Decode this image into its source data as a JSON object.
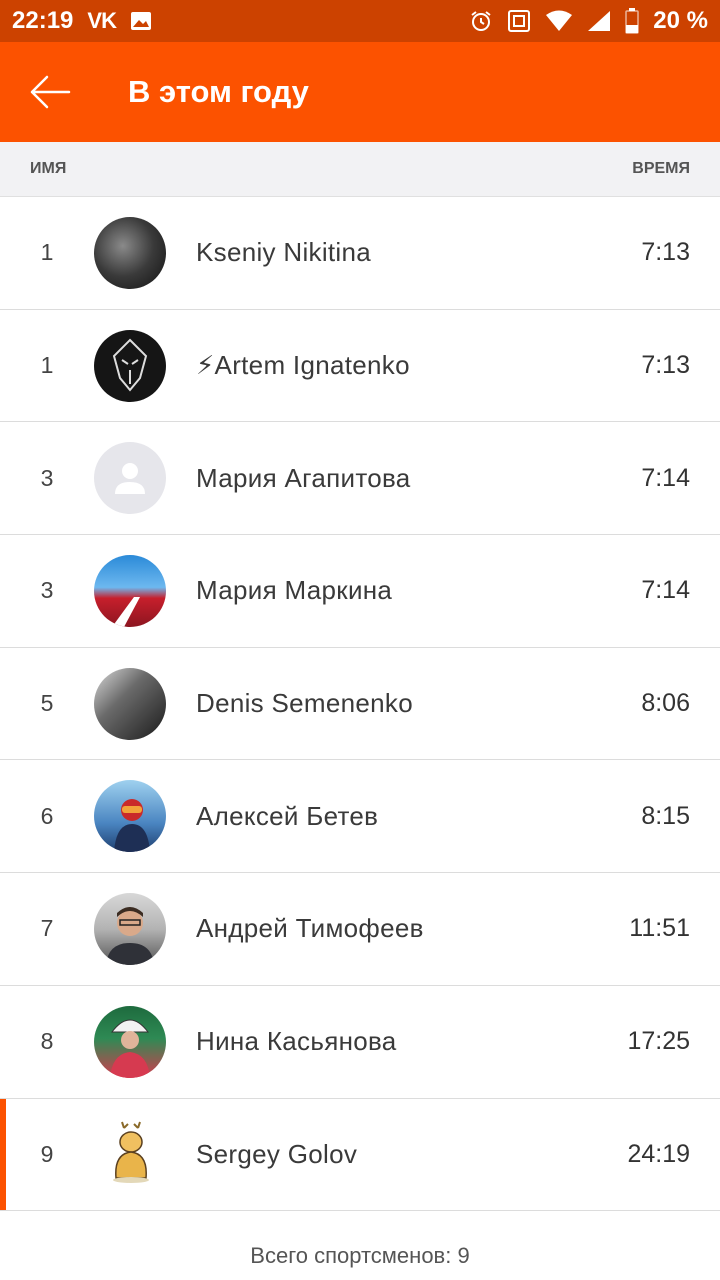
{
  "status_bar": {
    "time": "22:19",
    "vk": "VK",
    "battery_pct": "20 %",
    "icons": [
      "vk-icon",
      "image-icon",
      "alarm-icon",
      "nfc-icon",
      "wifi-icon",
      "signal-icon",
      "battery-icon"
    ]
  },
  "app_bar": {
    "title": "В этом году",
    "back_icon": "arrow-left-icon"
  },
  "table": {
    "col_name": "ИМЯ",
    "col_time": "ВРЕМЯ",
    "rows": [
      {
        "rank": "1",
        "name": "Kseniy Nikitina",
        "time": "7:13"
      },
      {
        "rank": "1",
        "name": "⚡Artem Ignatenko",
        "time": "7:13"
      },
      {
        "rank": "3",
        "name": "Мария Агапитова",
        "time": "7:14"
      },
      {
        "rank": "3",
        "name": "Мария Маркина",
        "time": "7:14"
      },
      {
        "rank": "5",
        "name": "Denis Semenenko",
        "time": "8:06"
      },
      {
        "rank": "6",
        "name": "Алексей Бетев",
        "time": "8:15"
      },
      {
        "rank": "7",
        "name": "Андрей Тимофеев",
        "time": "11:51"
      },
      {
        "rank": "8",
        "name": "Нина Касьянова",
        "time": "17:25"
      },
      {
        "rank": "9",
        "name": "Sergey Golov",
        "time": "24:19"
      }
    ]
  },
  "footer": {
    "total": "Всего спортсменов: 9"
  },
  "colors": {
    "accent": "#fc5200",
    "status_bar": "#cc4200"
  }
}
